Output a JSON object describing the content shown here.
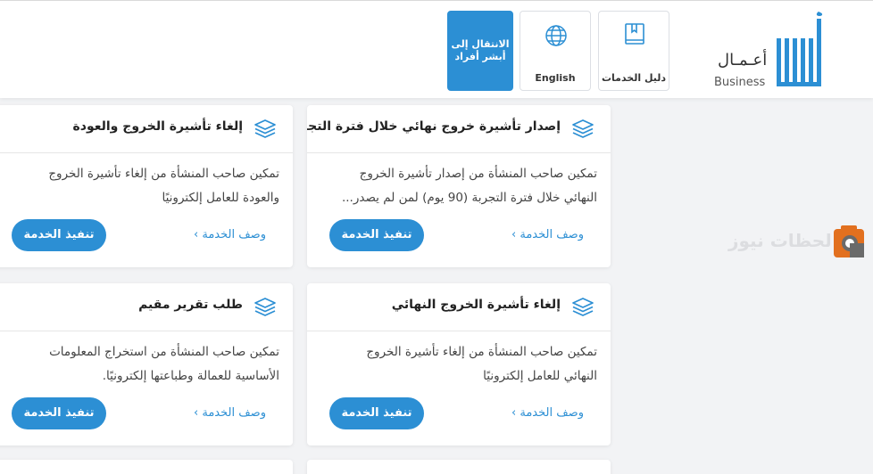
{
  "header": {
    "logo_text_ar": "أعـمـال",
    "logo_text_en": "Business",
    "guide_label": "دليل الخدمات",
    "language_label": "English",
    "switch_label_line1": "الانتقال إلى",
    "switch_label_line2": "أبشر أفراد"
  },
  "cards": [
    {
      "title": "إصدار تأشيرة خروج نهائي خلال فترة التجربة",
      "desc_line1": "تمكين صاحب المنشأة من إصدار تأشيرة الخروج",
      "desc_line2": "النهائي خلال فترة التجربة (90 يوم) لمن لم يصدر...",
      "execute": "تنفيذ الخدمة",
      "describe": "وصف الخدمة ›"
    },
    {
      "title": "إلغاء تأشيرة الخروج والعودة",
      "desc_line1": "تمكين صاحب المنشأة من إلغاء تأشيرة الخروج",
      "desc_line2": "والعودة للعامل إلكترونيًا",
      "execute": "تنفيذ الخدمة",
      "describe": "وصف الخدمة ›"
    },
    {
      "title": "إلغاء تأشيرة الخروج النهائي",
      "desc_line1": "تمكين صاحب المنشأة من إلغاء تأشيرة الخروج",
      "desc_line2": "النهائي للعامل إلكترونيًا",
      "execute": "تنفيذ الخدمة",
      "describe": "وصف الخدمة ›"
    },
    {
      "title": "طلب تقرير مقيم",
      "desc_line1": "تمكين صاحب المنشأة من استخراج المعلومات",
      "desc_line2": "الأساسية للعمالة وطباعتها إلكترونيًا.",
      "execute": "تنفيذ الخدمة",
      "describe": "وصف الخدمة ›"
    }
  ],
  "watermark_text": "لحظات نيوز",
  "colors": {
    "accent": "#2c8fd4",
    "background": "#f2f3f5",
    "card": "#ffffff",
    "title_text": "#222222"
  },
  "icons": {
    "guide": "book-icon",
    "language": "globe-icon",
    "card": "layers-icon"
  }
}
